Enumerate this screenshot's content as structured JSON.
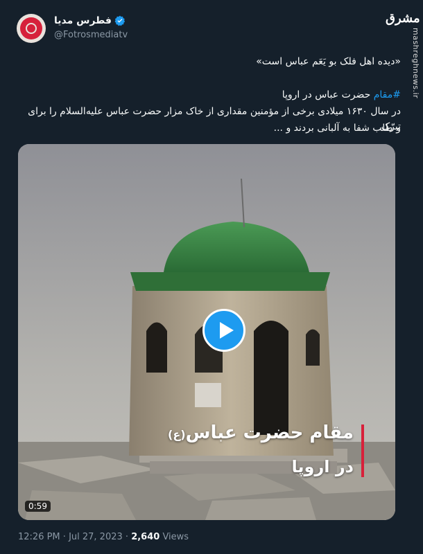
{
  "account": {
    "name": "فطرس مدیا",
    "handle": "@Fotrosmediatv"
  },
  "watermark": {
    "logo": "مشرق",
    "side_text": "mashreghnews.ir"
  },
  "tweet": {
    "quote": "«دیده اهل فلک بو یَعَم عباس است»",
    "hashtag": "#مقام",
    "hashtag_rest": " حضرت عباس در اروپا",
    "body_line1": "در سال ۱۶۳۰ میلادی برخی از مؤمنین مقداری از خاک مزار حضرت عباس علیه‌السلام را برای تبرّک",
    "body_line2": "و طلب شفا به آلبانی بردند و ..."
  },
  "media": {
    "caption_main": "مقام حضرت عباس",
    "caption_suffix": "(ع)",
    "caption_sub": "در اروپا",
    "duration": "0:59"
  },
  "meta": {
    "time": "12:26 PM",
    "sep": " · ",
    "date": "Jul 27, 2023",
    "sep2": " · ",
    "views": "2,640",
    "views_label": " Views"
  },
  "colors": {
    "background": "#15202b",
    "accent": "#1d9bf0",
    "dome": "#2f7a3d"
  }
}
